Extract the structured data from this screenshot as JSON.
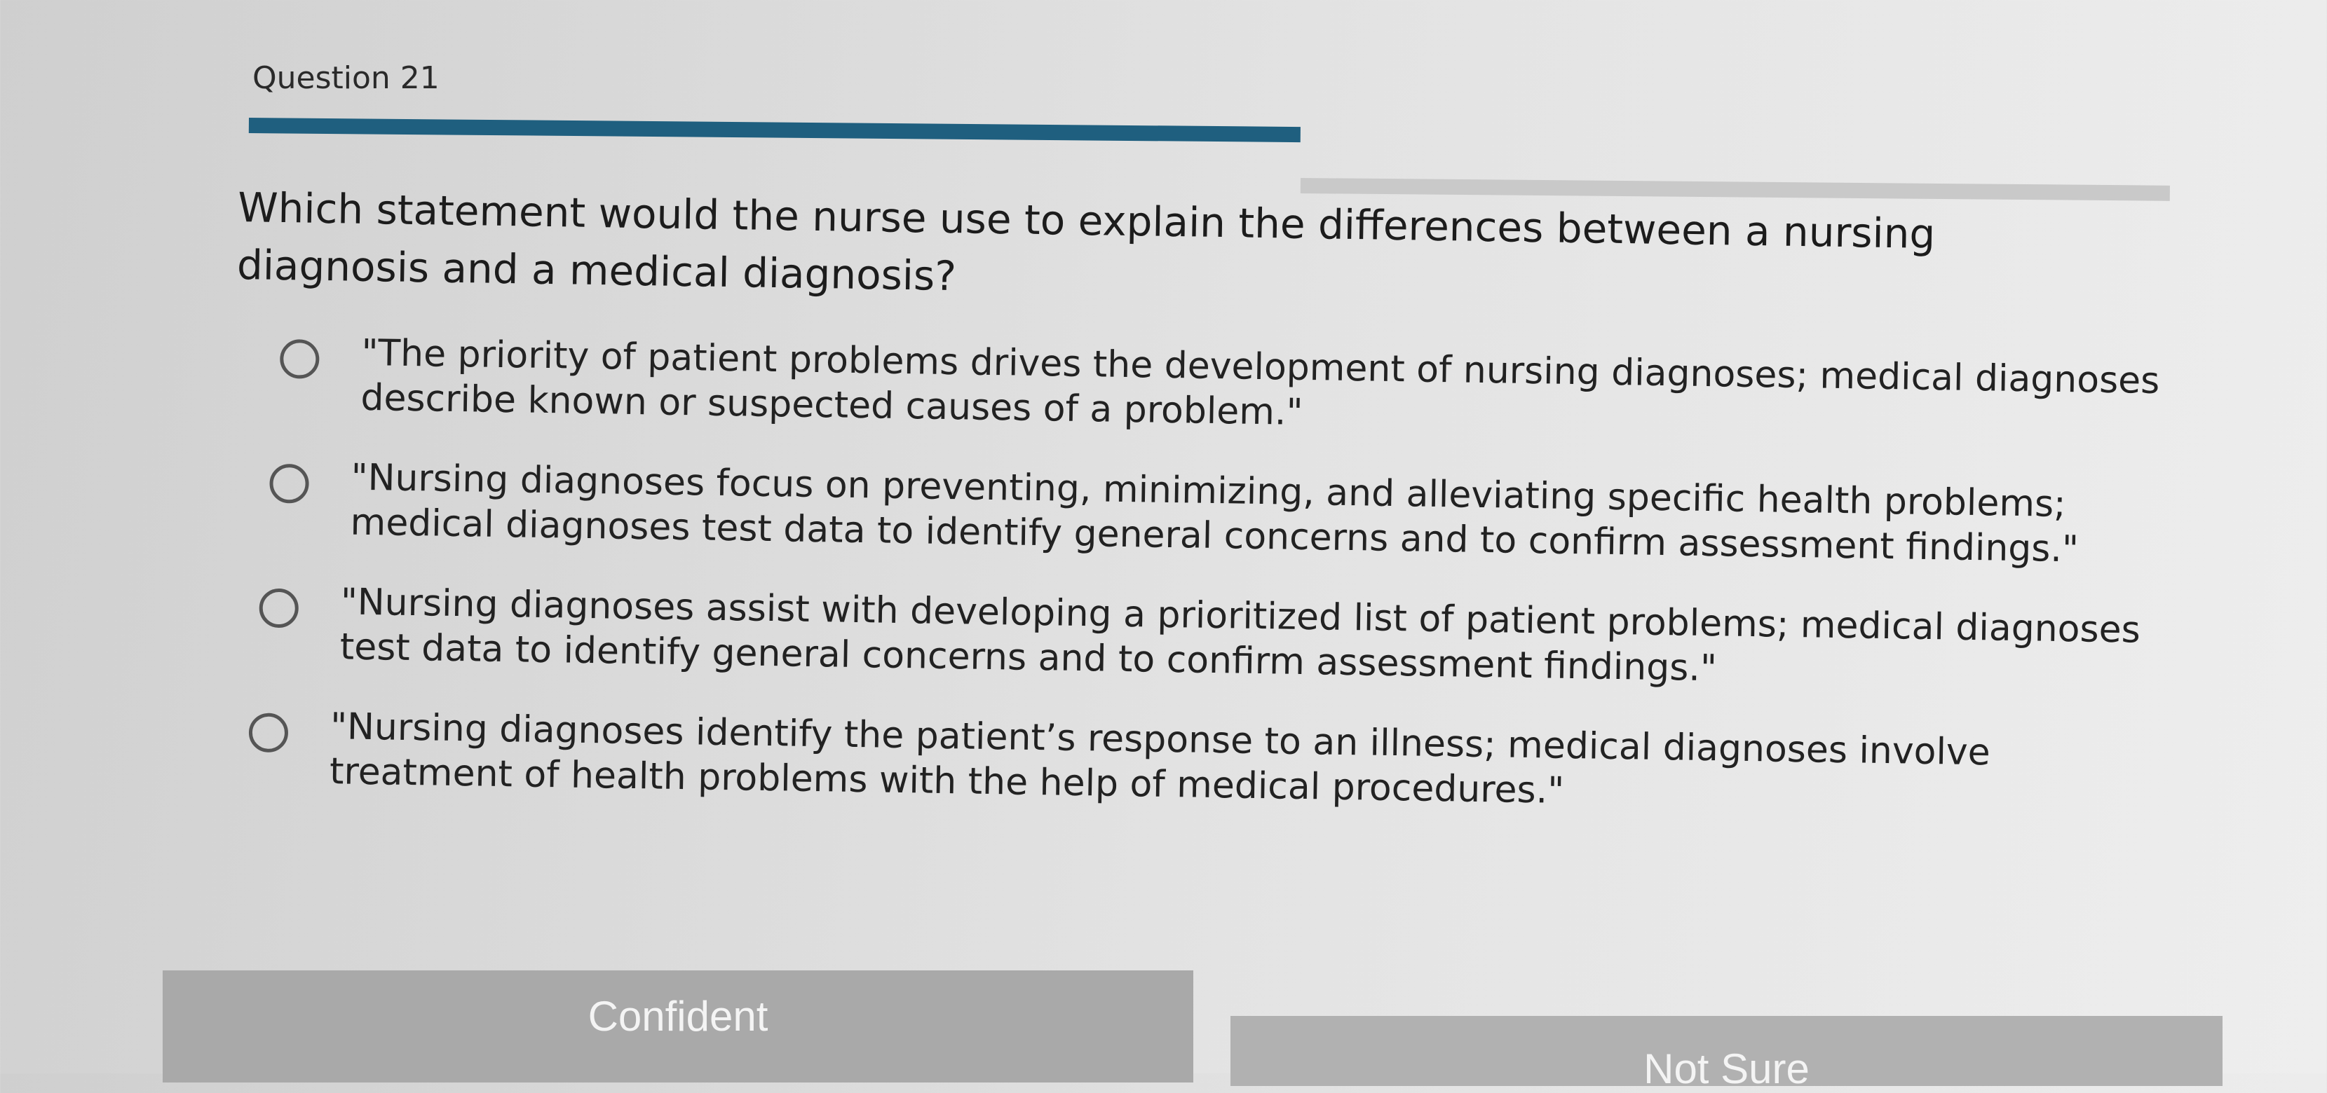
{
  "question": {
    "number_label": "Question 21",
    "stem": "Which statement would the nurse use to explain the differences between a nursing diagnosis and a medical diagnosis?"
  },
  "options": [
    {
      "text": "\"The priority of patient problems drives the development of nursing diagnoses; medical diagnoses describe known or suspected causes of a problem.\""
    },
    {
      "text": "\"Nursing diagnoses focus on preventing, minimizing, and alleviating specific health problems; medical diagnoses test data to identify general concerns and to confirm assessment findings.\""
    },
    {
      "text": "\"Nursing diagnoses assist with developing a prioritized list of patient problems; medical diagnoses test data to identify general concerns and to confirm assessment findings.\""
    },
    {
      "text": "\"Nursing diagnoses identify the patient’s response to an illness; medical diagnoses involve treatment of health problems with the help of medical procedures.\""
    }
  ],
  "buttons": {
    "confident_label": "Confident",
    "not_sure_label": "Not Sure"
  },
  "colors": {
    "progress_bar": "#1f5f7f",
    "button_bg": "#a9a9a9",
    "button_text": "#f4f4f4"
  }
}
